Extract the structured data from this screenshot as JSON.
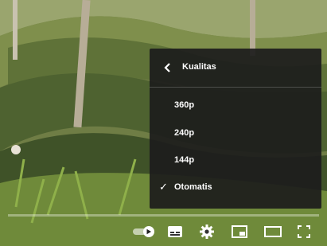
{
  "quality_menu": {
    "title": "Kualitas",
    "options": [
      {
        "label": "360p",
        "selected": false
      },
      {
        "label": "240p",
        "selected": false
      },
      {
        "label": "144p",
        "selected": false
      },
      {
        "label": "Otomatis",
        "selected": true
      }
    ],
    "check_glyph": "✓"
  },
  "controls": {
    "autoplay_toggle": {
      "icon": "autoplay-toggle-icon",
      "on": true
    },
    "subtitles_icon": "subtitles-icon",
    "settings_icon": "gear-icon",
    "miniplayer_icon": "miniplayer-icon",
    "theater_icon": "theater-mode-icon",
    "fullscreen_icon": "fullscreen-icon"
  },
  "colors": {
    "menu_bg": "#1c1c1c",
    "text": "#ffffff"
  }
}
